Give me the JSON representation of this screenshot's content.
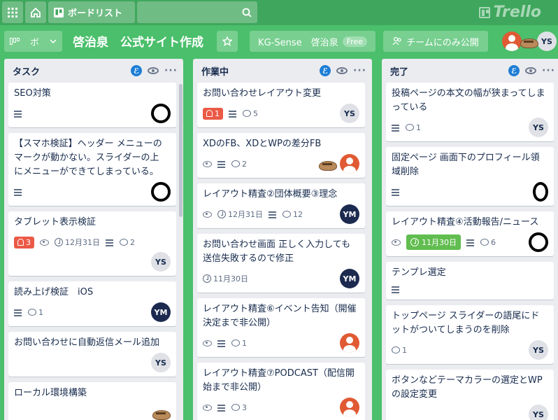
{
  "topbar": {
    "apps_icon": "grid-icon",
    "home_icon": "home-icon",
    "boards_label": "ボードリスト",
    "search_placeholder": "",
    "logo": "Trello"
  },
  "board": {
    "view_label": "ボ",
    "title": "啓治泉　公式サイト作成",
    "team_label": "KG-Sense　啓治泉",
    "team_plan": "Free",
    "visibility_label": "チームにのみ公開",
    "member_initials": "YS"
  },
  "lists": [
    {
      "name": "タスク",
      "cards": [
        {
          "title": "SEO対策",
          "desc": true
        },
        {
          "title": "【スマホ検証】ヘッダー メニューのマークが動かない。スライダーの上にメニューができてしまっている。",
          "desc": true
        },
        {
          "title": "タブレット表示検証",
          "notifications": "3",
          "watch": true,
          "due": "12月31日",
          "desc": true,
          "comments": "2",
          "member": "YS"
        },
        {
          "title": "読み上げ検証　iOS",
          "desc": true,
          "comments": "1",
          "member": "YM"
        },
        {
          "title": "お問い合わせに自動返信メール追加",
          "member": "YS"
        },
        {
          "title": "ローカル環境構築"
        }
      ]
    },
    {
      "name": "作業中",
      "cards": [
        {
          "title": "お問い合わせレイアウト変更",
          "notifications": "1",
          "desc": true,
          "comments": "5",
          "member": "YS"
        },
        {
          "title": "XDのFB、XDとWPの差分FB",
          "watch": true,
          "desc": true,
          "comments": "2"
        },
        {
          "title": "レイアウト精査②団体概要③理念",
          "watch": true,
          "due": "12月31日",
          "desc": true,
          "comments": "12",
          "member": "YM"
        },
        {
          "title": "お問い合わせ画面 正しく入力しても送信失敗するので修正",
          "due": "11月30日",
          "member": "YM"
        },
        {
          "title": "レイアウト精査⑥イベント告知（開催決定まで非公開）",
          "watch": true,
          "desc": true,
          "comments": "1"
        },
        {
          "title": "レイアウト精査⑦PODCAST（配信開始まで非公開）",
          "watch": true,
          "desc": true,
          "comments": "3"
        }
      ]
    },
    {
      "name": "完了",
      "cards": [
        {
          "title": "投稿ページの本文の幅が狭まってしまっている",
          "desc": true,
          "comments": "1",
          "member": "YS"
        },
        {
          "title": "固定ページ 画面下のプロフィール領域削除",
          "desc": true
        },
        {
          "title": "レイアウト精査④活動報告/ニュース",
          "watch": true,
          "due": "11月30日",
          "desc": true,
          "comments": "6"
        },
        {
          "title": "テンプレ選定",
          "desc": true
        },
        {
          "title": "トップページ スライダーの語尾にドットがついてしまうのを削除",
          "comments": "1",
          "member": "YS"
        },
        {
          "title": "ボタンなどテーマカラーの選定とWPの設定変更",
          "member": "YS"
        }
      ]
    }
  ]
}
